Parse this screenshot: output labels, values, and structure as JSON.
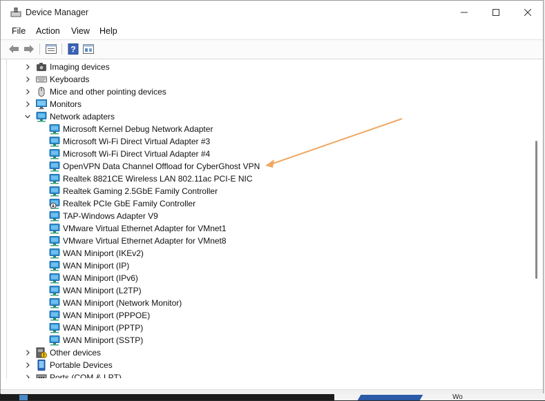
{
  "window": {
    "title": "Device Manager",
    "controls": [
      "minimize",
      "maximize",
      "close"
    ]
  },
  "menu": [
    "File",
    "Action",
    "View",
    "Help"
  ],
  "toolbar": [
    "back-icon",
    "forward-icon",
    "properties-icon",
    "help-icon",
    "update-icon"
  ],
  "tree": {
    "items": [
      {
        "label": "Imaging devices",
        "level": 0,
        "expanded": false,
        "icon": "camera-icon"
      },
      {
        "label": "Keyboards",
        "level": 0,
        "expanded": false,
        "icon": "keyboard-icon"
      },
      {
        "label": "Mice and other pointing devices",
        "level": 0,
        "expanded": false,
        "icon": "mouse-icon"
      },
      {
        "label": "Monitors",
        "level": 0,
        "expanded": false,
        "icon": "monitor-icon"
      },
      {
        "label": "Network adapters",
        "level": 0,
        "expanded": true,
        "icon": "network-icon"
      },
      {
        "label": "Microsoft Kernel Debug Network Adapter",
        "level": 1,
        "icon": "network-icon"
      },
      {
        "label": "Microsoft Wi-Fi Direct Virtual Adapter #3",
        "level": 1,
        "icon": "network-icon"
      },
      {
        "label": "Microsoft Wi-Fi Direct Virtual Adapter #4",
        "level": 1,
        "icon": "network-icon"
      },
      {
        "label": "OpenVPN Data Channel Offload for CyberGhost VPN",
        "level": 1,
        "icon": "network-icon"
      },
      {
        "label": "Realtek 8821CE Wireless LAN 802.11ac PCI-E NIC",
        "level": 1,
        "icon": "network-icon"
      },
      {
        "label": "Realtek Gaming 2.5GbE Family Controller",
        "level": 1,
        "icon": "network-icon"
      },
      {
        "label": "Realtek PCIe GbE Family Controller",
        "level": 1,
        "icon": "network-disabled-icon"
      },
      {
        "label": "TAP-Windows Adapter V9",
        "level": 1,
        "icon": "network-icon"
      },
      {
        "label": "VMware Virtual Ethernet Adapter for VMnet1",
        "level": 1,
        "icon": "network-icon"
      },
      {
        "label": "VMware Virtual Ethernet Adapter for VMnet8",
        "level": 1,
        "icon": "network-icon"
      },
      {
        "label": "WAN Miniport (IKEv2)",
        "level": 1,
        "icon": "network-icon"
      },
      {
        "label": "WAN Miniport (IP)",
        "level": 1,
        "icon": "network-icon"
      },
      {
        "label": "WAN Miniport (IPv6)",
        "level": 1,
        "icon": "network-icon"
      },
      {
        "label": "WAN Miniport (L2TP)",
        "level": 1,
        "icon": "network-icon"
      },
      {
        "label": "WAN Miniport (Network Monitor)",
        "level": 1,
        "icon": "network-icon"
      },
      {
        "label": "WAN Miniport (PPPOE)",
        "level": 1,
        "icon": "network-icon"
      },
      {
        "label": "WAN Miniport (PPTP)",
        "level": 1,
        "icon": "network-icon"
      },
      {
        "label": "WAN Miniport (SSTP)",
        "level": 1,
        "icon": "network-icon"
      },
      {
        "label": "Other devices",
        "level": 0,
        "expanded": false,
        "icon": "unknown-device-icon"
      },
      {
        "label": "Portable Devices",
        "level": 0,
        "expanded": false,
        "icon": "portable-device-icon"
      },
      {
        "label": "Ports (COM & LPT)",
        "level": 0,
        "expanded": false,
        "icon": "port-icon"
      }
    ]
  },
  "desktop": {
    "partial_text": "Wo"
  },
  "colors": {
    "annotation_arrow": "#f0a862",
    "network_icon": "#2f8fd0"
  }
}
